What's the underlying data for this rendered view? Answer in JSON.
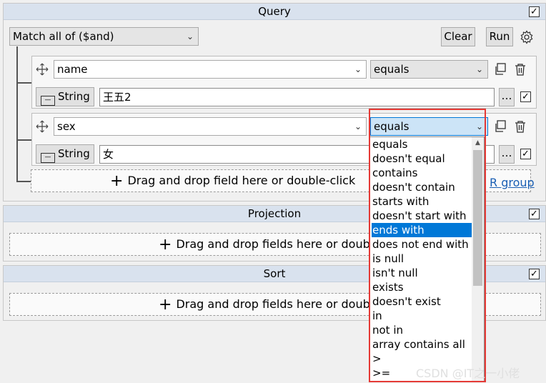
{
  "query": {
    "title": "Query",
    "match_mode": "Match all of ($and)",
    "clear_label": "Clear",
    "run_label": "Run",
    "rules": [
      {
        "field": "name",
        "operator": "equals",
        "type": "String",
        "value": "王五2"
      },
      {
        "field": "sex",
        "operator": "equals",
        "type": "String",
        "value": "女"
      }
    ],
    "add_field_hint": "Drag and drop field here or double-click",
    "or_group_link": "R group"
  },
  "projection": {
    "title": "Projection",
    "add_fields_hint": "Drag and drop fields here or double-"
  },
  "sort": {
    "title": "Sort",
    "add_fields_hint": "Drag and drop fields here or double-"
  },
  "operator_dropdown": {
    "selected": "ends with",
    "options": [
      "equals",
      "doesn't equal",
      "contains",
      "doesn't contain",
      "starts with",
      "doesn't start with",
      "ends with",
      "does not end with",
      "is null",
      "isn't null",
      "exists",
      "doesn't exist",
      "in",
      "not in",
      "array contains all",
      ">",
      ">="
    ]
  },
  "checkbox_mark": "✓",
  "watermark": "CSDN @IT之一小佬",
  "colors": {
    "selection": "#0078d7",
    "highlight": "#e53935",
    "header": "#d9e2ee"
  }
}
